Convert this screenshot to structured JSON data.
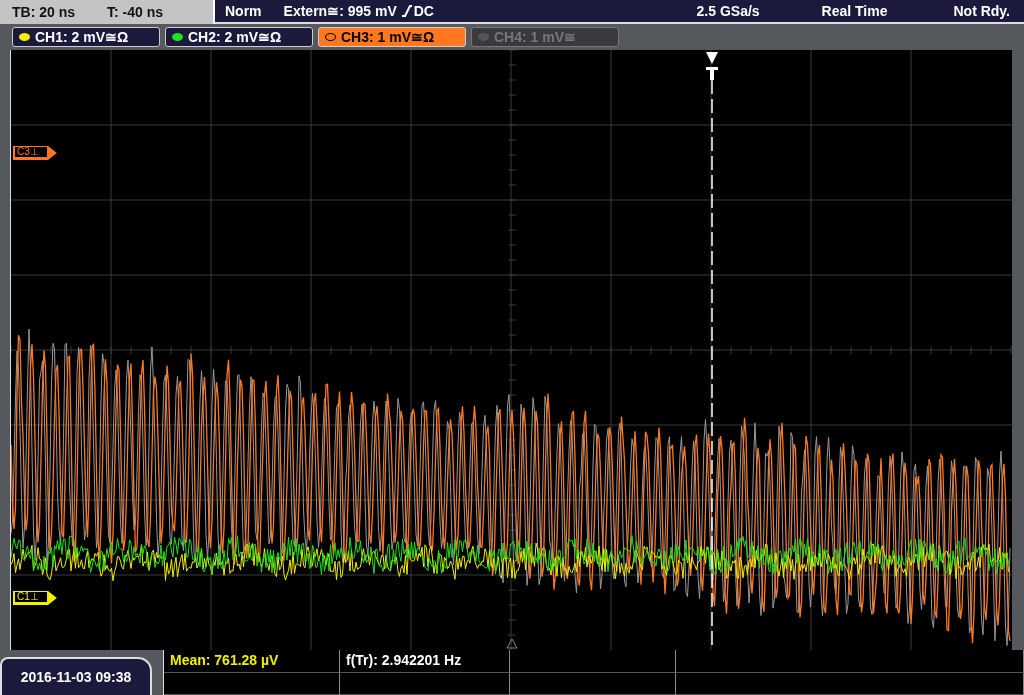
{
  "header": {
    "timebase": "TB: 20 ns",
    "trigger_time": "T: -40 ns",
    "mode": "Norm",
    "trigger_source": "Extern≅: 995 mV",
    "coupling": "DC",
    "sample_rate": "2.5 GSa/s",
    "acquisition": "Real Time",
    "status": "Not Rdy."
  },
  "channels": [
    {
      "label": "CH1: 2 mV≅Ω",
      "color": "#f0f000",
      "selected": false,
      "on": true
    },
    {
      "label": "CH2: 2 mV≅Ω",
      "color": "#20e020",
      "selected": false,
      "on": true
    },
    {
      "label": "CH3: 1 mV≅Ω",
      "color": "#ff7820",
      "selected": true,
      "on": true
    },
    {
      "label": "CH4: 1 mV≅",
      "selected": false,
      "on": false
    }
  ],
  "markers": [
    {
      "label": "C3⊥",
      "color": "#ff7820"
    },
    {
      "label": "C1⊥",
      "color": "#f0f000"
    }
  ],
  "timestamp": "2016-11-03 09:38",
  "measurements": [
    {
      "text": "Mean: 761.28 µV",
      "color": "#f0f000"
    },
    {
      "text": "f(Tr): 2.942201 Hz",
      "color": "#ffffff"
    }
  ]
}
